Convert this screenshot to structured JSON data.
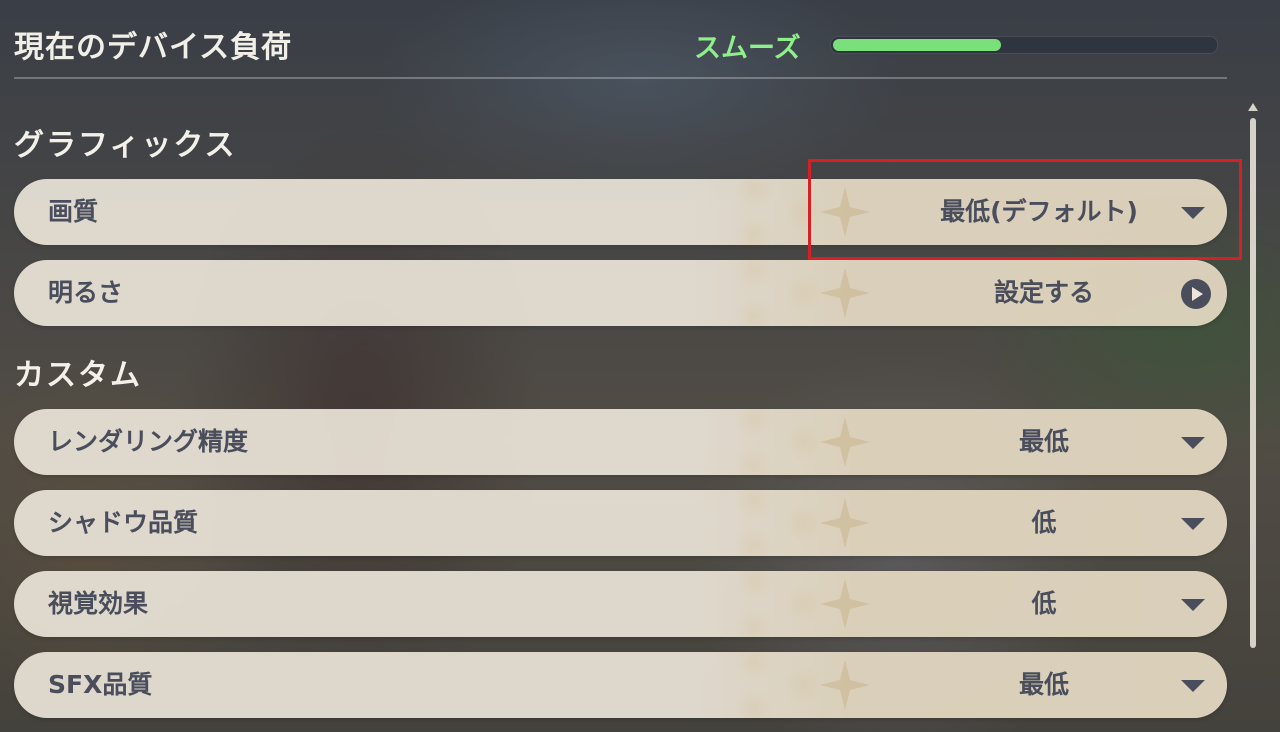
{
  "header": {
    "title": "現在のデバイス負荷",
    "status": "スムーズ",
    "load_fraction": 0.44,
    "status_color": "#8ef08a"
  },
  "sections": [
    {
      "title": "グラフィックス",
      "rows": [
        {
          "label": "画質",
          "value": "最低(デフォルト)",
          "control": "dropdown"
        },
        {
          "label": "明るさ",
          "value": "設定する",
          "control": "arrow"
        }
      ]
    },
    {
      "title": "カスタム",
      "rows": [
        {
          "label": "レンダリング精度",
          "value": "最低",
          "control": "dropdown"
        },
        {
          "label": "シャドウ品質",
          "value": "低",
          "control": "dropdown"
        },
        {
          "label": "視覚効果",
          "value": "低",
          "control": "dropdown"
        },
        {
          "label": "SFX品質",
          "value": "最低",
          "control": "dropdown"
        }
      ]
    }
  ],
  "highlight_color": "#d62028",
  "icons": [
    "chevron-down-icon",
    "arrow-circle-icon",
    "scroll-up-icon"
  ]
}
